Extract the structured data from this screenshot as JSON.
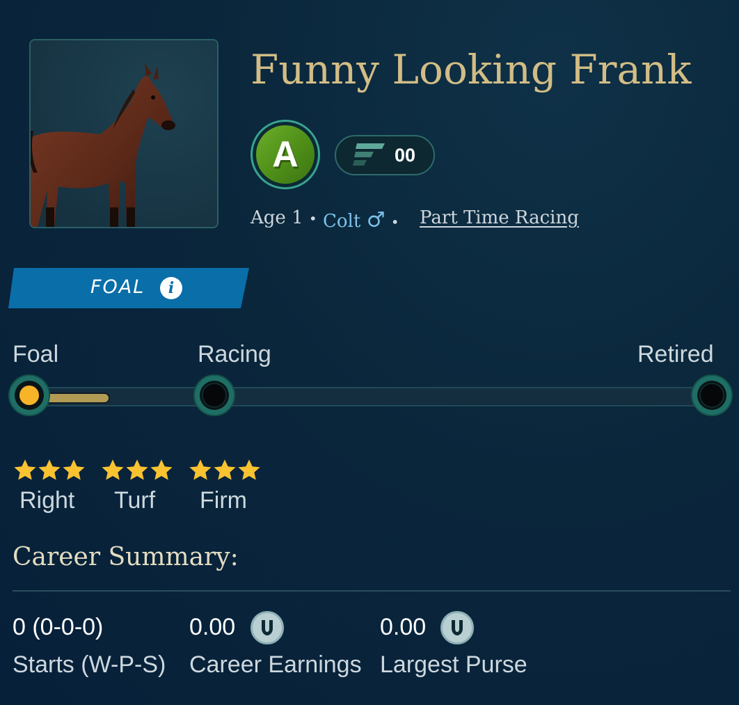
{
  "horse": {
    "name": "Funny Looking Frank",
    "grade": "A",
    "rating": "00",
    "age": "Age 1",
    "sex": "Colt",
    "racing_mode": "Part Time Racing",
    "portrait_icon": "horse-portrait"
  },
  "stage": {
    "banner_label": "FOAL",
    "info_icon": "info-icon",
    "labels": [
      "Foal",
      "Racing",
      "Retired"
    ],
    "progress_fraction": 0.11
  },
  "preferences": [
    {
      "label": "Right",
      "stars": 3
    },
    {
      "label": "Turf",
      "stars": 3
    },
    {
      "label": "Firm",
      "stars": 3
    }
  ],
  "career": {
    "title": "Career Summary:",
    "starts_value": "0 (0-0-0)",
    "starts_label": "Starts (W-P-S)",
    "earnings_value": "0.00",
    "earnings_label": "Career Earnings",
    "purse_value": "0.00",
    "purse_label": "Largest Purse",
    "currency_icon": "horseshoe-coin-icon"
  },
  "colors": {
    "background": "#0a263b",
    "name_gold": "#d2bd85",
    "grade_green": "#5a9e20",
    "banner_blue": "#0a6ea8",
    "star_gold": "#f8c231",
    "progress_gold": "#b29b55",
    "colt_blue": "#7cc3ea"
  }
}
